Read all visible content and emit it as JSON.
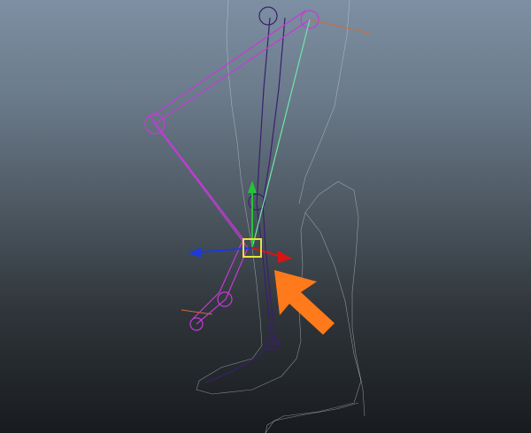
{
  "viewport": {
    "bg_top": "#7d8fa3",
    "bg_bottom": "#181b1e"
  },
  "colors": {
    "mesh": "#d8dde3",
    "joint_selected": "#c43bd6",
    "joint_default": "#3a1f6e",
    "ik_handle": "#6ee6a8",
    "manip_x": "#d61515",
    "manip_y": "#27c23a",
    "manip_z": "#1e3ad6",
    "manip_center": "#e8e23a",
    "arrow": "#ff7a1a"
  },
  "icons": {
    "annotation": "orange-arrow-icon",
    "move_tool": "move-manipulator-icon"
  }
}
